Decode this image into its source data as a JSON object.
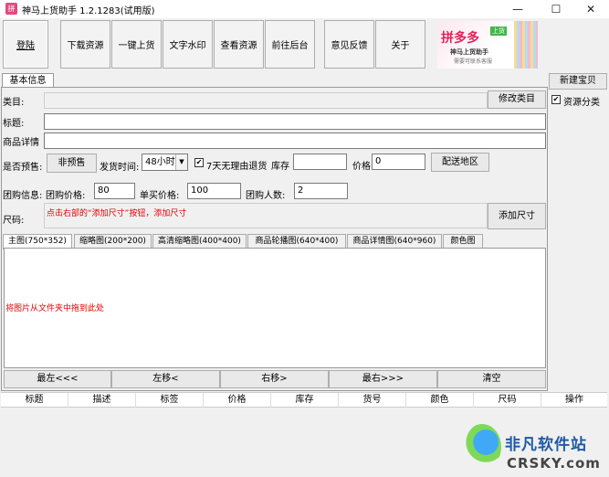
{
  "window": {
    "app_icon_glyph": "拼",
    "title": "神马上货助手 1.2.1283(试用版)",
    "minimize": "—",
    "maximize": "☐",
    "close": "✕"
  },
  "toolbar": {
    "login": "登陆",
    "download": "下载资源",
    "one_click": "一键上货",
    "watermark": "文字水印",
    "view_resources": "查看资源",
    "go_backend": "前往后台",
    "feedback": "意见反馈",
    "about": "关于"
  },
  "ad": {
    "brand": "拼多多",
    "badge": "上货",
    "line1": "神马上货助手",
    "line2": "需要可联系客服"
  },
  "tabs": {
    "basic_info": "基本信息"
  },
  "form": {
    "category_label": "类目:",
    "edit_category": "修改类目",
    "title_label": "标题:",
    "detail_label": "商品详情",
    "presale_label": "是否预售:",
    "presale_button": "非预售",
    "ship_time_label": "发货时间:",
    "ship_time_value": "48小时",
    "return_check": "✔",
    "return_label": "7天无理由退货",
    "stock_label": "库存",
    "stock_value": "",
    "price_label": "价格",
    "price_value": "0",
    "shipping_region": "配送地区",
    "group_info_label": "团购信息:",
    "group_price_label": "团购价格:",
    "group_price_value": "80",
    "single_price_label": "单买价格:",
    "single_price_value": "100",
    "group_size_label": "团购人数:",
    "group_size_value": "2",
    "size_label": "尺码:",
    "size_hint": "点击右部的“添加尺寸”按钮，添加尺寸",
    "add_size": "添加尺寸"
  },
  "image_tabs": [
    "主图(750*352)",
    "缩略图(200*200)",
    "高清缩略图(400*400)",
    "商品轮播图(640*400)",
    "商品详情图(640*960)",
    "颜色图"
  ],
  "drop_hint": "将图片从文件夹中拖到此处",
  "move_buttons": {
    "far_left": "最左<<<",
    "left": "左移<",
    "right": "右移>",
    "far_right": "最右>>>",
    "clear": "清空"
  },
  "right_panel": {
    "new_item": "新建宝贝",
    "resource_check": "✔",
    "resource_category": "资源分类"
  },
  "table_columns": [
    "标题",
    "描述",
    "标签",
    "价格",
    "库存",
    "货号",
    "颜色",
    "尺码",
    "操作"
  ],
  "watermark": {
    "cn": "非凡软件站",
    "en": "CRSKY.com"
  }
}
